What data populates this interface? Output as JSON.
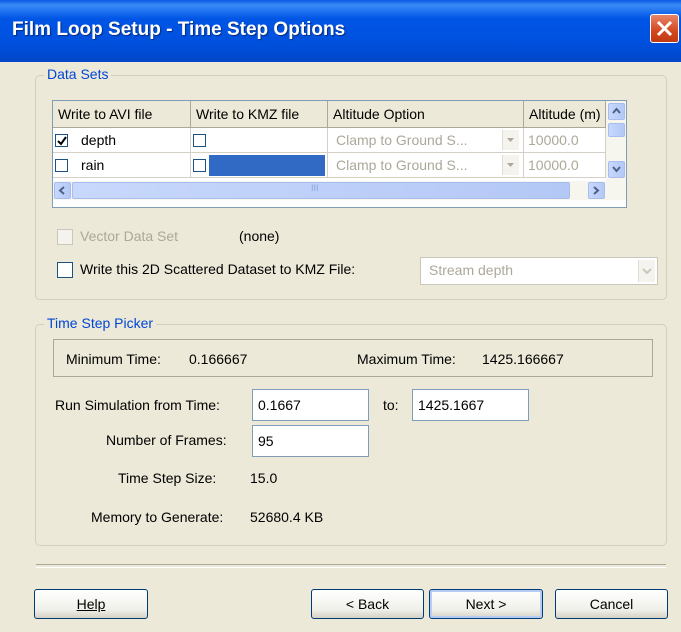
{
  "window": {
    "title": "Film Loop Setup - Time Step Options"
  },
  "data_sets": {
    "legend": "Data Sets",
    "columns": [
      "Write to AVI file",
      "Write to KMZ file",
      "Altitude Option",
      "Altitude (m)"
    ],
    "rows": [
      {
        "name": "depth",
        "write_avi": true,
        "write_kmz": false,
        "altitude_option": "Clamp to Ground S...",
        "altitude": "10000.0"
      },
      {
        "name": "rain",
        "write_avi": false,
        "write_kmz": false,
        "altitude_option": "Clamp to Ground S...",
        "altitude": "10000.0"
      }
    ],
    "scroll_mid_glyph": "III",
    "vector_label": "Vector Data Set",
    "vector_value": "(none)",
    "kmz_label": "Write this 2D Scattered Dataset to KMZ File:",
    "kmz_dataset": "Stream depth"
  },
  "time_step": {
    "legend": "Time Step Picker",
    "min_time_label": "Minimum Time:",
    "min_time_value": "0.166667",
    "max_time_label": "Maximum Time:",
    "max_time_value": "1425.166667",
    "run_label": "Run Simulation from Time:",
    "run_from": "0.1667",
    "to_label": "to:",
    "run_to": "1425.1667",
    "frames_label": "Number of Frames:",
    "frames_value": "95",
    "step_size_label": "Time Step Size:",
    "step_size_value": "15.0",
    "memory_label": "Memory to Generate:",
    "memory_value": "52680.4 KB"
  },
  "buttons": {
    "help": "Help",
    "back": "< Back",
    "next": "Next >",
    "cancel": "Cancel"
  },
  "colors": {
    "title_bar": "#0055E5",
    "accent_legend": "#0046D5",
    "dialog_bg": "#ECE9D8",
    "selection": "#316AC5"
  }
}
